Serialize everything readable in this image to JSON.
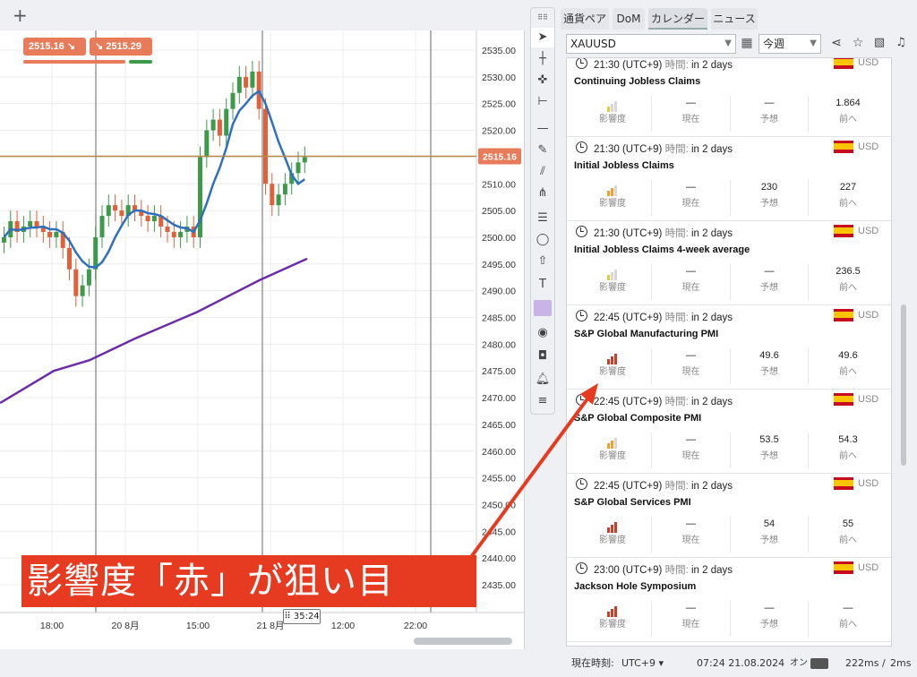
{
  "chart": {
    "tab_plus": "+",
    "bid_label": "2515.16",
    "ask_label": "2515.29",
    "current_price_tag": "2515.16",
    "price_ticks": [
      "2535.00",
      "2530.00",
      "2525.00",
      "2520.00",
      "2515.00",
      "2510.00",
      "2505.00",
      "2500.00",
      "2495.00",
      "2490.00",
      "2485.00",
      "2480.00",
      "2475.00",
      "2470.00",
      "2465.00",
      "2460.00",
      "2455.00",
      "2450.00",
      "2445.00",
      "2440.00",
      "2435.00"
    ],
    "time_ticks": [
      "18:00",
      "20 8月",
      "15:00",
      "21 8月",
      "12:00",
      "22:00"
    ],
    "cursor_time_badge": "35:24"
  },
  "right_panel": {
    "tabs": [
      "通貨ペア",
      "DoM",
      "カレンダー",
      "ニュース"
    ],
    "active_tab": "カレンダー",
    "symbol": "XAUUSD",
    "period": "今週"
  },
  "events": [
    {
      "time": "21:30 (UTC+9)",
      "when_label": "時間:",
      "when": "in 2 days",
      "currency": "USD",
      "title": "Continuing Jobless Claims",
      "impact": "low",
      "current": "—",
      "forecast": "—",
      "previous": "1.864"
    },
    {
      "time": "21:30 (UTC+9)",
      "when_label": "時間:",
      "when": "in 2 days",
      "currency": "USD",
      "title": "Initial Jobless Claims",
      "impact": "medium",
      "current": "—",
      "forecast": "230",
      "previous": "227"
    },
    {
      "time": "21:30 (UTC+9)",
      "when_label": "時間:",
      "when": "in 2 days",
      "currency": "USD",
      "title": "Initial Jobless Claims 4-week average",
      "impact": "low",
      "current": "—",
      "forecast": "—",
      "previous": "236.5"
    },
    {
      "time": "22:45 (UTC+9)",
      "when_label": "時間:",
      "when": "in 2 days",
      "currency": "USD",
      "title": "S&P Global Manufacturing PMI",
      "impact": "high",
      "current": "—",
      "forecast": "49.6",
      "previous": "49.6"
    },
    {
      "time": "22:45 (UTC+9)",
      "when_label": "時間:",
      "when": "in 2 days",
      "currency": "USD",
      "title": "S&P Global Composite PMI",
      "impact": "medium",
      "current": "—",
      "forecast": "53.5",
      "previous": "54.3"
    },
    {
      "time": "22:45 (UTC+9)",
      "when_label": "時間:",
      "when": "in 2 days",
      "currency": "USD",
      "title": "S&P Global Services PMI",
      "impact": "high",
      "current": "—",
      "forecast": "54",
      "previous": "55"
    },
    {
      "time": "23:00 (UTC+9)",
      "when_label": "時間:",
      "when": "in 2 days",
      "currency": "USD",
      "title": "Jackson Hole Symposium",
      "impact": "high",
      "current": "—",
      "forecast": "—",
      "previous": "—"
    }
  ],
  "cell_labels": {
    "impact": "影響度",
    "current": "現在",
    "forecast": "予想",
    "previous": "前へ"
  },
  "impact_colors": {
    "low": "#e8c93a",
    "medium": "#f0a030",
    "high": "#c8402a"
  },
  "status": {
    "server_time_label": "現在時刻:",
    "tz": "UTC+9",
    "datetime": "07:24 21.08.2024",
    "on_label": "オン",
    "latency": "222ms",
    "latency2": "2ms"
  },
  "overlay_text": "影響度「赤」が狙い目"
}
